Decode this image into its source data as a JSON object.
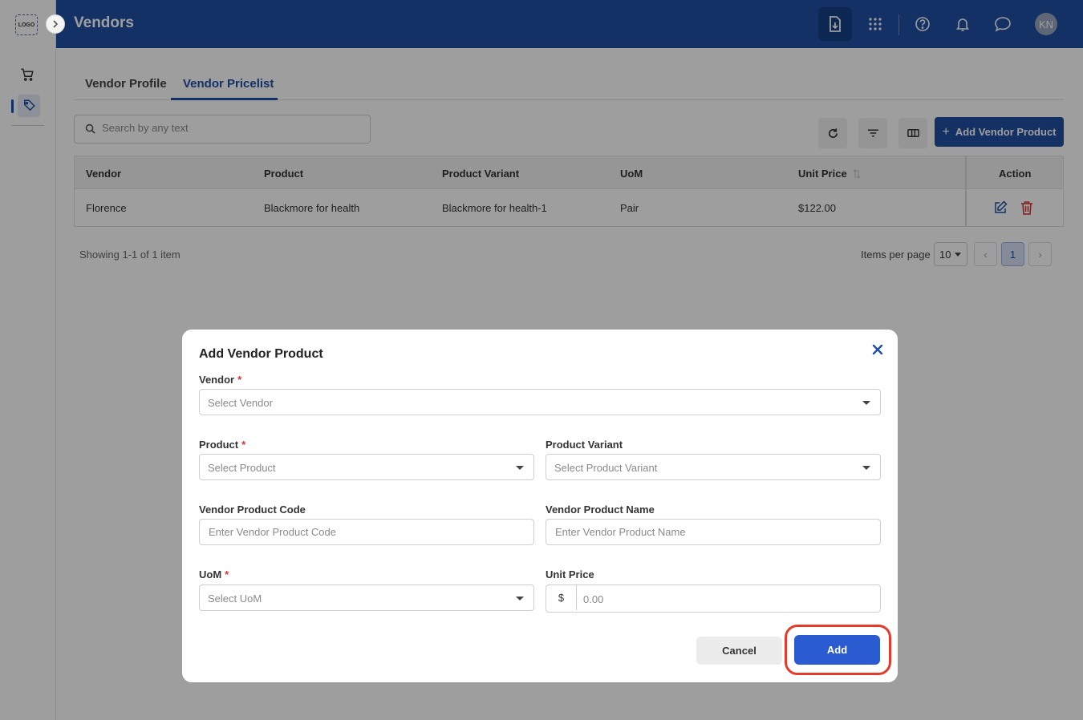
{
  "app": {
    "logo_text": "LOGO",
    "page_title": "Vendors",
    "avatar_initials": "KN",
    "brand_color": "#1f4fa3"
  },
  "sidebar": {
    "items": [
      {
        "name": "cart-icon",
        "active": false
      },
      {
        "name": "vendor-tag-icon",
        "active": true
      }
    ]
  },
  "header": {
    "icons": [
      "download-icon",
      "apps-grid-icon",
      "help-icon",
      "bell-icon",
      "chat-icon"
    ]
  },
  "tabs": [
    {
      "label": "Vendor Profile",
      "active": false
    },
    {
      "label": "Vendor Pricelist",
      "active": true
    }
  ],
  "search": {
    "placeholder": "Search by any text",
    "value": ""
  },
  "toolbar": {
    "add_label": "Add Vendor Product",
    "icons": [
      "refresh-icon",
      "filter-icon",
      "columns-icon"
    ]
  },
  "table": {
    "columns": [
      "Vendor",
      "Product",
      "Product Variant",
      "UoM",
      "Unit Price",
      "Action"
    ],
    "rows": [
      {
        "vendor": "Florence",
        "product": "Blackmore for health",
        "variant": "Blackmore for health-1",
        "uom": "Pair",
        "unit_price": "$122.00"
      }
    ]
  },
  "pagination": {
    "showing": "Showing 1-1 of 1 item",
    "items_per_page_label": "Items per page",
    "items_per_page": "10",
    "current_page": "1",
    "prev": "‹",
    "next": "›"
  },
  "modal": {
    "title": "Add Vendor Product",
    "fields": {
      "vendor": {
        "label": "Vendor",
        "placeholder": "Select Vendor",
        "required": true
      },
      "product": {
        "label": "Product",
        "placeholder": "Select Product",
        "required": true
      },
      "variant": {
        "label": "Product Variant",
        "placeholder": "Select Product Variant",
        "required": false
      },
      "code": {
        "label": "Vendor Product Code",
        "placeholder": "Enter Vendor Product Code",
        "required": false
      },
      "name": {
        "label": "Vendor Product Name",
        "placeholder": "Enter Vendor Product Name",
        "required": false
      },
      "uom": {
        "label": "UoM",
        "placeholder": "Select UoM",
        "required": true
      },
      "price": {
        "label": "Unit Price",
        "prefix": "$",
        "placeholder": "0.00",
        "required": false
      }
    },
    "required_mark": "*",
    "cancel_label": "Cancel",
    "add_label": "Add",
    "highlight_color": "#e63a2c"
  }
}
